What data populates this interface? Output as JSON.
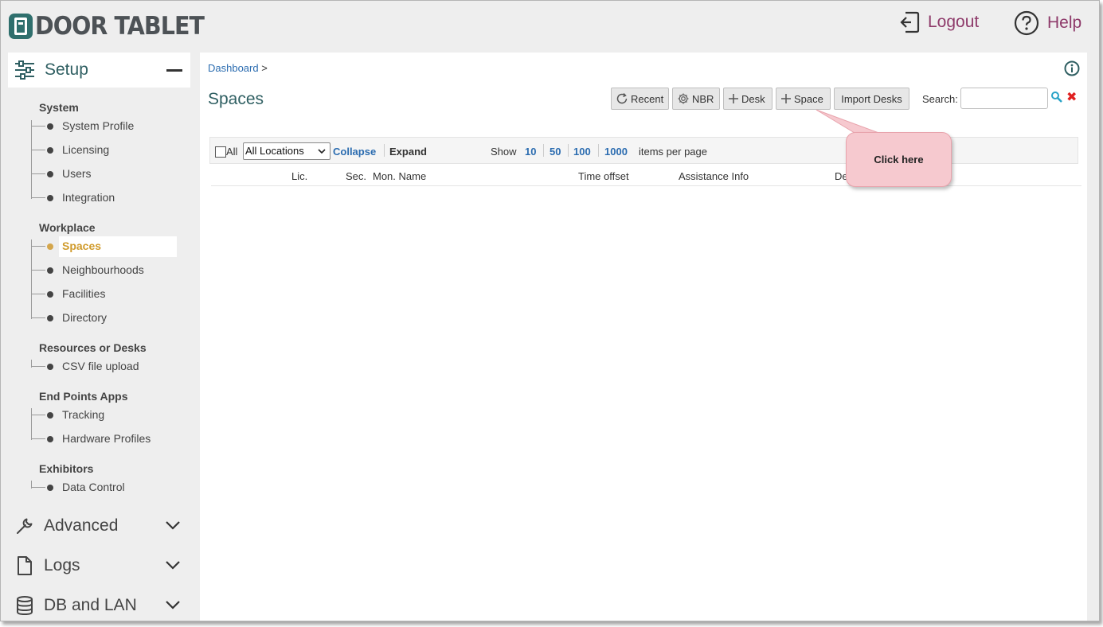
{
  "brand": {
    "name": "DOOR TABLET"
  },
  "header": {
    "logout_label": "Logout",
    "help_label": "Help"
  },
  "sidebar": {
    "setup_label": "Setup",
    "groups": [
      {
        "title": "System",
        "items": [
          "System Profile",
          "Licensing",
          "Users",
          "Integration"
        ]
      },
      {
        "title": "Workplace",
        "items": [
          "Spaces",
          "Neighbourhoods",
          "Facilities",
          "Directory"
        ]
      },
      {
        "title": "Resources or Desks",
        "items": [
          "CSV file upload"
        ]
      },
      {
        "title": "End Points Apps",
        "items": [
          "Tracking",
          "Hardware Profiles"
        ]
      },
      {
        "title": "Exhibitors",
        "items": [
          "Data Control"
        ]
      }
    ],
    "active_item": "Spaces",
    "sections": [
      "Advanced",
      "Logs",
      "DB and LAN"
    ]
  },
  "main": {
    "breadcrumb": {
      "link": "Dashboard",
      "separator": ">"
    },
    "title": "Spaces",
    "toolbar": {
      "recent": "Recent",
      "nbr": "NBR",
      "desk": "Desk",
      "space": "Space",
      "import_desks": "Import Desks",
      "search_label": "Search:",
      "search_value": ""
    },
    "listbar": {
      "all_label": "All",
      "location_selected": "All Locations",
      "collapse": "Collapse",
      "expand": "Expand",
      "show_label": "Show",
      "page_sizes": [
        "10",
        "50",
        "100",
        "1000"
      ],
      "items_per_page": "items per page"
    },
    "columns": [
      "Lic.",
      "Sec.",
      "Mon. Name",
      "Time offset",
      "Assistance Info",
      "De"
    ]
  },
  "callout": {
    "text": "Click here"
  },
  "colors": {
    "accent_teal": "#2f5f62",
    "link_blue": "#2b6cb0",
    "active_gold": "#d09b2c",
    "header_action": "#8e3a6a",
    "callout_pink": "#f6c9cf"
  }
}
